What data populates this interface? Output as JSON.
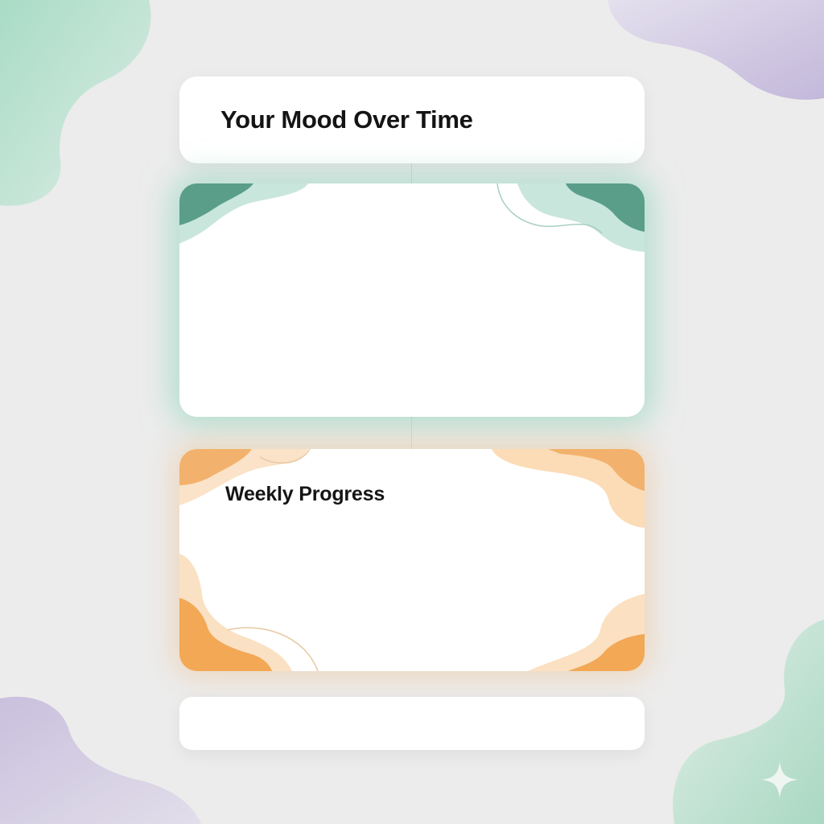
{
  "header": {
    "title": "Your Mood Over Time"
  },
  "mood_card": {
    "title": ""
  },
  "progress_card": {
    "title": "Weekly Progress"
  },
  "bottom_card": {
    "label": ""
  },
  "icons": {
    "sparkle": "sparkle-icon"
  },
  "colors": {
    "background": "#ececec",
    "mint_accent": "#81d2b7",
    "mint_dark": "#5a9e8a",
    "orange_accent": "#f0a85a",
    "lavender_accent": "#c9c0dd"
  }
}
